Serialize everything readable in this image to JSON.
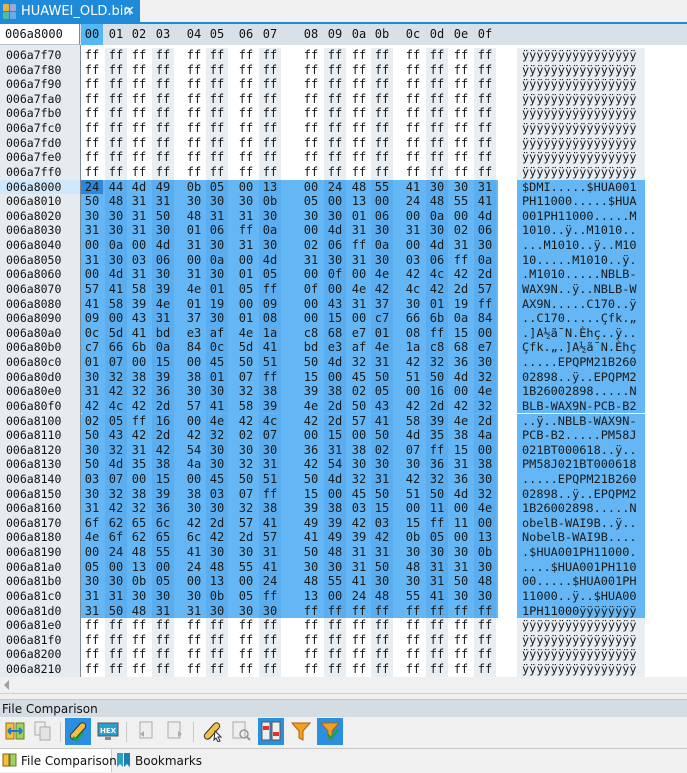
{
  "tab": {
    "title": "HUAWEI_OLD.bin",
    "close": "✕"
  },
  "header": {
    "offset": "006a8000",
    "columns": [
      "00",
      "01",
      "02",
      "03",
      "04",
      "05",
      "06",
      "07",
      "08",
      "09",
      "0a",
      "0b",
      "0c",
      "0d",
      "0e",
      "0f"
    ]
  },
  "selection": {
    "start": "006a8000",
    "end": "006a81d0",
    "cursor_byte": "006a8000"
  },
  "rows": [
    {
      "addr": "006a7f70",
      "hex": "ff ff ff ff ff ff ff ff ff ff ff ff ff ff ff ff",
      "ascii": "ÿÿÿÿÿÿÿÿÿÿÿÿÿÿÿÿ"
    },
    {
      "addr": "006a7f80",
      "hex": "ff ff ff ff ff ff ff ff ff ff ff ff ff ff ff ff",
      "ascii": "ÿÿÿÿÿÿÿÿÿÿÿÿÿÿÿÿ"
    },
    {
      "addr": "006a7f90",
      "hex": "ff ff ff ff ff ff ff ff ff ff ff ff ff ff ff ff",
      "ascii": "ÿÿÿÿÿÿÿÿÿÿÿÿÿÿÿÿ"
    },
    {
      "addr": "006a7fa0",
      "hex": "ff ff ff ff ff ff ff ff ff ff ff ff ff ff ff ff",
      "ascii": "ÿÿÿÿÿÿÿÿÿÿÿÿÿÿÿÿ"
    },
    {
      "addr": "006a7fb0",
      "hex": "ff ff ff ff ff ff ff ff ff ff ff ff ff ff ff ff",
      "ascii": "ÿÿÿÿÿÿÿÿÿÿÿÿÿÿÿÿ"
    },
    {
      "addr": "006a7fc0",
      "hex": "ff ff ff ff ff ff ff ff ff ff ff ff ff ff ff ff",
      "ascii": "ÿÿÿÿÿÿÿÿÿÿÿÿÿÿÿÿ"
    },
    {
      "addr": "006a7fd0",
      "hex": "ff ff ff ff ff ff ff ff ff ff ff ff ff ff ff ff",
      "ascii": "ÿÿÿÿÿÿÿÿÿÿÿÿÿÿÿÿ"
    },
    {
      "addr": "006a7fe0",
      "hex": "ff ff ff ff ff ff ff ff ff ff ff ff ff ff ff ff",
      "ascii": "ÿÿÿÿÿÿÿÿÿÿÿÿÿÿÿÿ"
    },
    {
      "addr": "006a7ff0",
      "hex": "ff ff ff ff ff ff ff ff ff ff ff ff ff ff ff ff",
      "ascii": "ÿÿÿÿÿÿÿÿÿÿÿÿÿÿÿÿ"
    },
    {
      "addr": "006a8000",
      "hex": "24 44 4d 49 0b 05 00 13 00 24 48 55 41 30 30 31",
      "ascii": "$DMI.....$HUA001"
    },
    {
      "addr": "006a8010",
      "hex": "50 48 31 31 30 30 30 0b 05 00 13 00 24 48 55 41",
      "ascii": "PH11000.....$HUA"
    },
    {
      "addr": "006a8020",
      "hex": "30 30 31 50 48 31 31 30 30 30 01 06 00 0a 00 4d",
      "ascii": "001PH11000.....M"
    },
    {
      "addr": "006a8030",
      "hex": "31 30 31 30 01 06 ff 0a 00 4d 31 30 31 30 02 06",
      "ascii": "1010..ÿ..M1010.."
    },
    {
      "addr": "006a8040",
      "hex": "00 0a 00 4d 31 30 31 30 02 06 ff 0a 00 4d 31 30",
      "ascii": "...M1010..ÿ..M10"
    },
    {
      "addr": "006a8050",
      "hex": "31 30 03 06 00 0a 00 4d 31 30 31 30 03 06 ff 0a",
      "ascii": "10.....M1010..ÿ."
    },
    {
      "addr": "006a8060",
      "hex": "00 4d 31 30 31 30 01 05 00 0f 00 4e 42 4c 42 2d",
      "ascii": ".M1010.....NBLB-"
    },
    {
      "addr": "006a8070",
      "hex": "57 41 58 39 4e 01 05 ff 0f 00 4e 42 4c 42 2d 57",
      "ascii": "WAX9N..ÿ..NBLB-W"
    },
    {
      "addr": "006a8080",
      "hex": "41 58 39 4e 01 19 00 09 00 43 31 37 30 01 19 ff",
      "ascii": "AX9N.....C170..ÿ"
    },
    {
      "addr": "006a8090",
      "hex": "09 00 43 31 37 30 01 08 00 15 00 c7 66 6b 0a 84",
      "ascii": "..C170.....Çfk.„"
    },
    {
      "addr": "006a80a0",
      "hex": "0c 5d 41 bd e3 af 4e 1a c8 68 e7 01 08 ff 15 00",
      "ascii": ".]A½ã¯N.Èhç..ÿ.."
    },
    {
      "addr": "006a80b0",
      "hex": "c7 66 6b 0a 84 0c 5d 41 bd e3 af 4e 1a c8 68 e7",
      "ascii": "Çfk.„.]A½ã¯N.Èhç"
    },
    {
      "addr": "006a80c0",
      "hex": "01 07 00 15 00 45 50 51 50 4d 32 31 42 32 36 30",
      "ascii": ".....EPQPM21B260"
    },
    {
      "addr": "006a80d0",
      "hex": "30 32 38 39 38 01 07 ff 15 00 45 50 51 50 4d 32",
      "ascii": "02898..ÿ..EPQPM2"
    },
    {
      "addr": "006a80e0",
      "hex": "31 42 32 36 30 30 32 38 39 38 02 05 00 16 00 4e",
      "ascii": "1B26002898.....N"
    },
    {
      "addr": "006a80f0",
      "hex": "42 4c 42 2d 57 41 58 39 4e 2d 50 43 42 2d 42 32",
      "ascii": "BLB-WAX9N-PCB-B2"
    },
    {
      "addr": "006a8100",
      "hex": "02 05 ff 16 00 4e 42 4c 42 2d 57 41 58 39 4e 2d",
      "ascii": "..ÿ..NBLB-WAX9N-"
    },
    {
      "addr": "006a8110",
      "hex": "50 43 42 2d 42 32 02 07 00 15 00 50 4d 35 38 4a",
      "ascii": "PCB-B2.....PM58J"
    },
    {
      "addr": "006a8120",
      "hex": "30 32 31 42 54 30 30 30 36 31 38 02 07 ff 15 00",
      "ascii": "021BT000618..ÿ.."
    },
    {
      "addr": "006a8130",
      "hex": "50 4d 35 38 4a 30 32 31 42 54 30 30 30 36 31 38",
      "ascii": "PM58J021BT000618"
    },
    {
      "addr": "006a8140",
      "hex": "03 07 00 15 00 45 50 51 50 4d 32 31 42 32 36 30",
      "ascii": ".....EPQPM21B260"
    },
    {
      "addr": "006a8150",
      "hex": "30 32 38 39 38 03 07 ff 15 00 45 50 51 50 4d 32",
      "ascii": "02898..ÿ..EPQPM2"
    },
    {
      "addr": "006a8160",
      "hex": "31 42 32 36 30 30 32 38 39 38 03 15 00 11 00 4e",
      "ascii": "1B26002898.....N"
    },
    {
      "addr": "006a8170",
      "hex": "6f 62 65 6c 42 2d 57 41 49 39 42 03 15 ff 11 00",
      "ascii": "obelB-WAI9B..ÿ.."
    },
    {
      "addr": "006a8180",
      "hex": "4e 6f 62 65 6c 42 2d 57 41 49 39 42 0b 05 00 13",
      "ascii": "NobelB-WAI9B...."
    },
    {
      "addr": "006a8190",
      "hex": "00 24 48 55 41 30 30 31 50 48 31 31 30 30 30 0b",
      "ascii": ".$HUA001PH11000."
    },
    {
      "addr": "006a81a0",
      "hex": "05 00 13 00 24 48 55 41 30 30 31 50 48 31 31 30",
      "ascii": "....$HUA001PH110"
    },
    {
      "addr": "006a81b0",
      "hex": "30 30 0b 05 00 13 00 24 48 55 41 30 30 31 50 48",
      "ascii": "00.....$HUA001PH"
    },
    {
      "addr": "006a81c0",
      "hex": "31 31 30 30 30 0b 05 ff 13 00 24 48 55 41 30 30",
      "ascii": "11000..ÿ..$HUA00"
    },
    {
      "addr": "006a81d0",
      "hex": "31 50 48 31 31 30 30 30 ff ff ff ff ff ff ff ff",
      "ascii": "1PH11000ÿÿÿÿÿÿÿÿ"
    },
    {
      "addr": "006a81e0",
      "hex": "ff ff ff ff ff ff ff ff ff ff ff ff ff ff ff ff",
      "ascii": "ÿÿÿÿÿÿÿÿÿÿÿÿÿÿÿÿ"
    },
    {
      "addr": "006a81f0",
      "hex": "ff ff ff ff ff ff ff ff ff ff ff ff ff ff ff ff",
      "ascii": "ÿÿÿÿÿÿÿÿÿÿÿÿÿÿÿÿ"
    },
    {
      "addr": "006a8200",
      "hex": "ff ff ff ff ff ff ff ff ff ff ff ff ff ff ff ff",
      "ascii": "ÿÿÿÿÿÿÿÿÿÿÿÿÿÿÿÿ"
    },
    {
      "addr": "006a8210",
      "hex": "ff ff ff ff ff ff ff ff ff ff ff ff ff ff ff ff",
      "ascii": "ÿÿÿÿÿÿÿÿÿÿÿÿÿÿÿÿ"
    }
  ],
  "panel": {
    "title": "File Comparison",
    "toolbar": [
      "compare-files-icon",
      "copy-icon",
      "pill-check-icon",
      "hex-view-icon",
      "prev-diff-icon",
      "next-diff-icon",
      "pill-cursor-icon",
      "search-doc-icon",
      "side-by-side-icon",
      "filter-icon",
      "filter-check-icon"
    ]
  },
  "bottom_tabs": [
    {
      "label": "File Comparison",
      "active": true
    },
    {
      "label": "Bookmarks",
      "active": false
    }
  ],
  "colors": {
    "accent": "#1f8ad8",
    "selection": "#64b7f4",
    "cursor": "#2f86d6"
  }
}
